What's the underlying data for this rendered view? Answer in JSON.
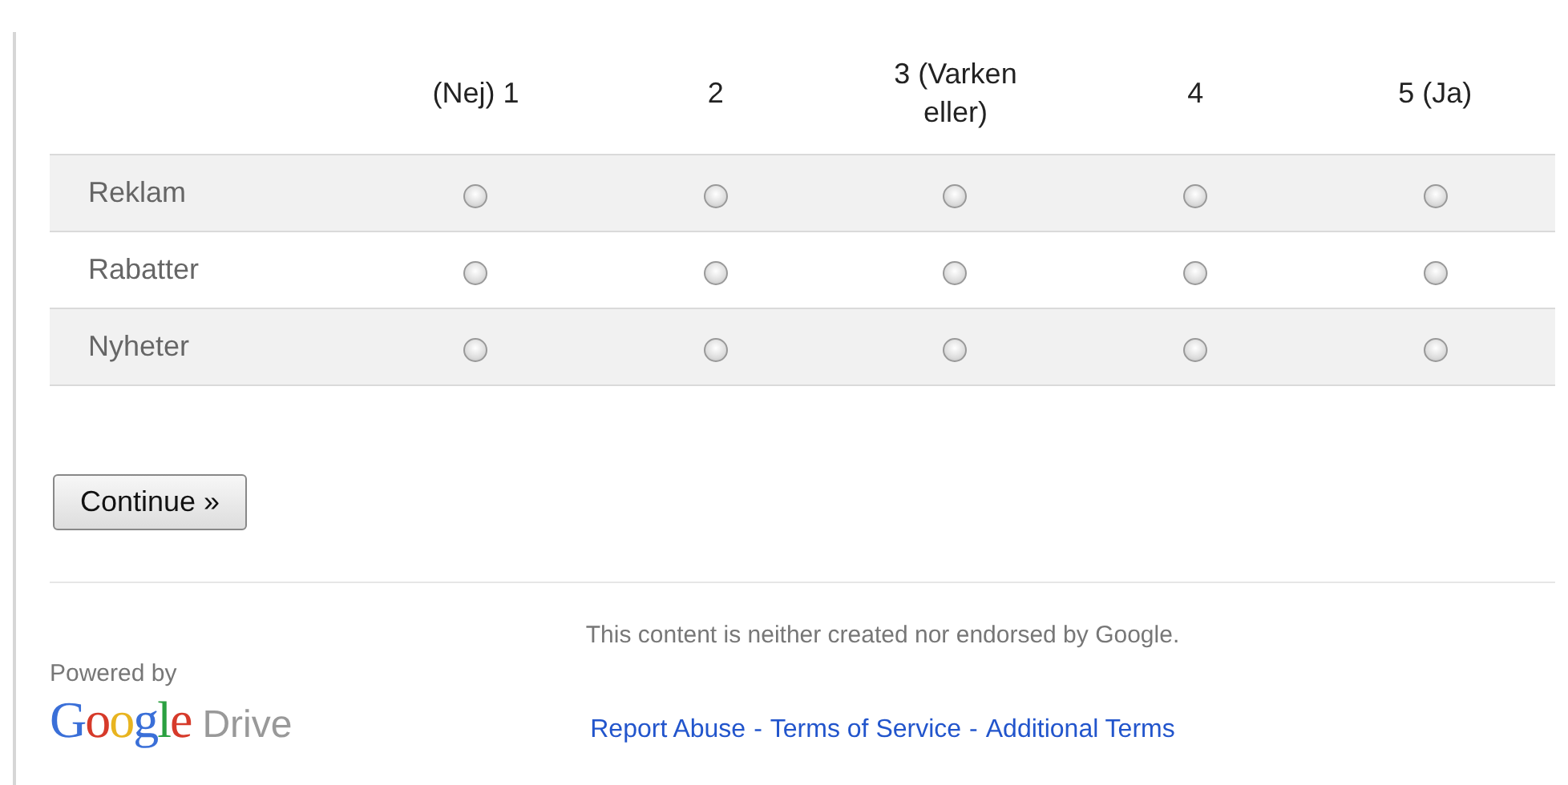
{
  "grid": {
    "columns": [
      "(Nej) 1",
      "2",
      "3 (Varken eller)",
      "4",
      "5 (Ja)"
    ],
    "rows": [
      {
        "label": "Reklam",
        "choices": [
          {
            "selected": false
          },
          {
            "selected": false
          },
          {
            "selected": false
          },
          {
            "selected": false
          },
          {
            "selected": false
          }
        ]
      },
      {
        "label": "Rabatter",
        "choices": [
          {
            "selected": false
          },
          {
            "selected": false
          },
          {
            "selected": false
          },
          {
            "selected": false
          },
          {
            "selected": false
          }
        ]
      },
      {
        "label": "Nyheter",
        "choices": [
          {
            "selected": false
          },
          {
            "selected": false
          },
          {
            "selected": false
          },
          {
            "selected": false
          },
          {
            "selected": false
          }
        ]
      }
    ]
  },
  "continue_button": "Continue »",
  "footer": {
    "disclaimer": "This content is neither created nor endorsed by Google.",
    "powered_by": "Powered by",
    "logo": {
      "brand": "Google",
      "product": "Drive"
    },
    "links": [
      "Report Abuse",
      "Terms of Service",
      "Additional Terms"
    ],
    "separator": "-"
  }
}
